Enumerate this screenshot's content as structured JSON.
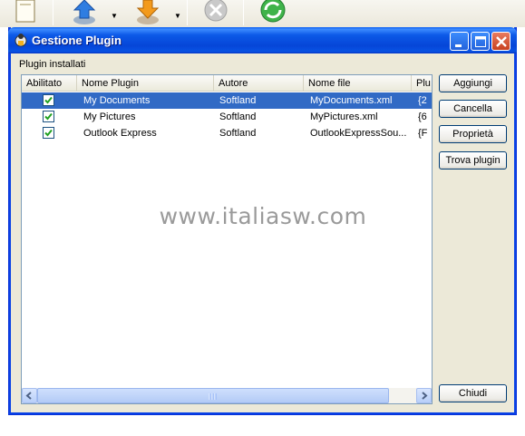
{
  "window": {
    "title": "Gestione Plugin",
    "controls": [
      "minimize",
      "maximize",
      "close"
    ]
  },
  "group_label": "Plugin installati",
  "table": {
    "columns": [
      "Abilitato",
      "Nome Plugin",
      "Autore",
      "Nome file",
      "Plu"
    ],
    "rows": [
      {
        "enabled": true,
        "name": "My Documents",
        "author": "Softland",
        "file": "MyDocuments.xml",
        "extra": "{2",
        "selected": true
      },
      {
        "enabled": true,
        "name": "My Pictures",
        "author": "Softland",
        "file": "MyPictures.xml",
        "extra": "{6",
        "selected": false
      },
      {
        "enabled": true,
        "name": "Outlook Express",
        "author": "Softland",
        "file": "OutlookExpressSou...",
        "extra": "{F",
        "selected": false
      }
    ]
  },
  "buttons": {
    "add": "Aggiungi",
    "delete": "Cancella",
    "properties": "Proprietà",
    "find": "Trova plugin",
    "close": "Chiudi"
  },
  "watermark": "www.italiasw.com",
  "colors": {
    "titlebar": "#0a5ff2",
    "selection": "#316ac5",
    "dialog_bg": "#ece9d8"
  }
}
